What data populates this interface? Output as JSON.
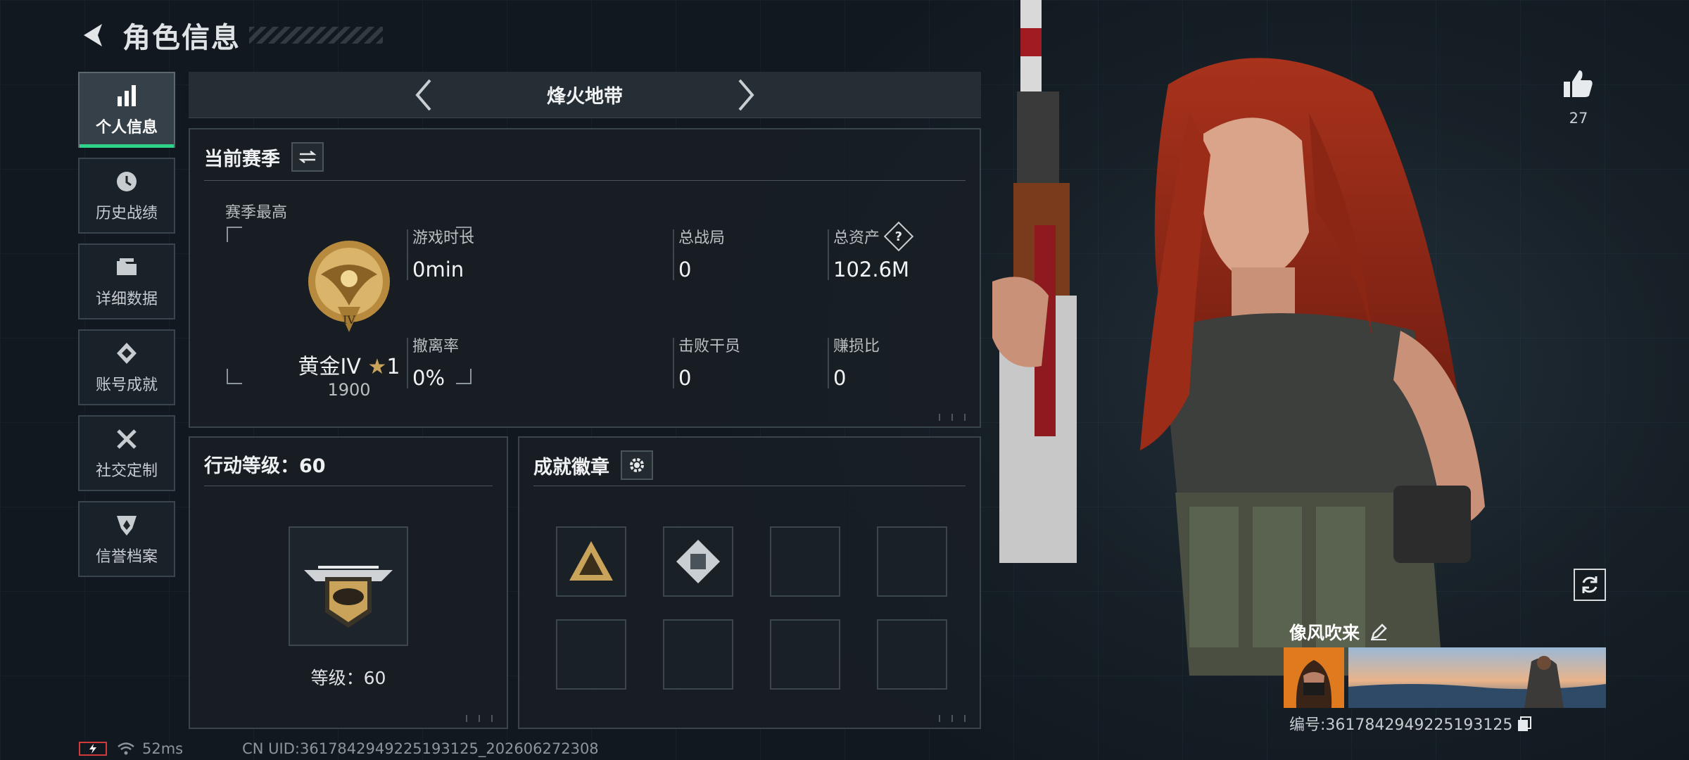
{
  "header": {
    "title": "角色信息"
  },
  "sidebar": {
    "items": [
      {
        "label": "个人信息",
        "icon": "bar-chart-icon",
        "active": true
      },
      {
        "label": "历史战绩",
        "icon": "history-clock-icon",
        "active": false
      },
      {
        "label": "详细数据",
        "icon": "folder-icon",
        "active": false
      },
      {
        "label": "账号成就",
        "icon": "achievement-icon",
        "active": false
      },
      {
        "label": "社交定制",
        "icon": "tools-icon",
        "active": false
      },
      {
        "label": "信誉档案",
        "icon": "shield-emblem-icon",
        "active": false
      }
    ]
  },
  "mode": {
    "name": "烽火地带"
  },
  "season": {
    "title": "当前赛季",
    "best_label": "赛季最高",
    "rank_name": "黄金IV",
    "rank_stars": "1",
    "rank_score": "1900",
    "stats": [
      {
        "label": "游戏时长",
        "value": "0min"
      },
      {
        "label": "总战局",
        "value": "0"
      },
      {
        "label": "总资产",
        "value": "102.6M",
        "help": "?"
      },
      {
        "label": "撤离率",
        "value": "0%"
      },
      {
        "label": "击败干员",
        "value": "0"
      },
      {
        "label": "赚损比",
        "value": "0"
      }
    ]
  },
  "level": {
    "title": "行动等级：60",
    "level_text": "等级：60"
  },
  "achievements": {
    "title": "成就徽章",
    "slots": [
      "warning-triangle-badge",
      "cube-diamond-badge",
      "",
      "",
      "",
      "",
      "",
      ""
    ]
  },
  "footer": {
    "ping": "52ms",
    "uid": "CN UID:3617842949225193125_202606272308"
  },
  "profile": {
    "likes": "27",
    "name": "像风吹来",
    "id_text": "编号:3617842949225193125"
  },
  "colors": {
    "accent_green": "#2fd38a",
    "gold": "#c9a35a"
  }
}
